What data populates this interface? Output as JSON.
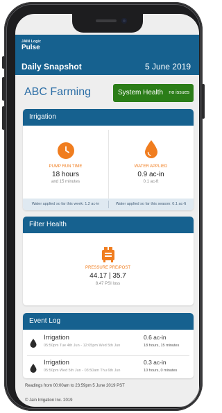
{
  "header": {
    "brand_small": "JAIN Logic",
    "brand_name": "Pulse",
    "title": "Daily Snapshot",
    "date": "5 June 2019"
  },
  "farm": {
    "name": "ABC Farming"
  },
  "system_health": {
    "label": "System Health",
    "status": "no issues",
    "color": "#2b7d18"
  },
  "irrigation": {
    "title": "Irrigation",
    "pump_run_time": {
      "label": "PUMP RUN TIME",
      "value": "18 hours",
      "sub": "and 15 minutes",
      "icon": "clock-icon"
    },
    "water_applied": {
      "label": "WATER APPLIED",
      "value": "0.9 ac-in",
      "sub": "0.1 ac-ft",
      "icon": "water-drop-icon"
    },
    "week_text": "Water applied so far this week: 1.2 ac-in",
    "season_text": "Water applied so far this season: 0.1 ac-ft"
  },
  "filter_health": {
    "title": "Filter Health",
    "label": "PRESSURE PRE/POST",
    "value": "44.17 | 35.7",
    "sub": "8.47 PSI loss",
    "icon": "filter-icon"
  },
  "event_log": {
    "title": "Event Log",
    "events": [
      {
        "title": "Irrigation",
        "time": "05:50pm Tue 4th Jun - 12:05pm Wed 5th Jun",
        "volume": "0.6 ac-in",
        "duration": "18 hours, 15 minutes"
      },
      {
        "title": "Irrigation",
        "time": "05:50pm Wed 5th Jun - 03:50am Thu 6th Jun",
        "volume": "0.3 ac-in",
        "duration": "10 hours, 0 minutes"
      }
    ]
  },
  "footer": {
    "readings": "Readings from 00:00am to 23:59pm 5 June 2019 PST",
    "copyright": "© Jain Irrigation Inc. 2019"
  },
  "colors": {
    "primary": "#16618f",
    "accent": "#f07d1f",
    "health": "#2b7d18"
  }
}
